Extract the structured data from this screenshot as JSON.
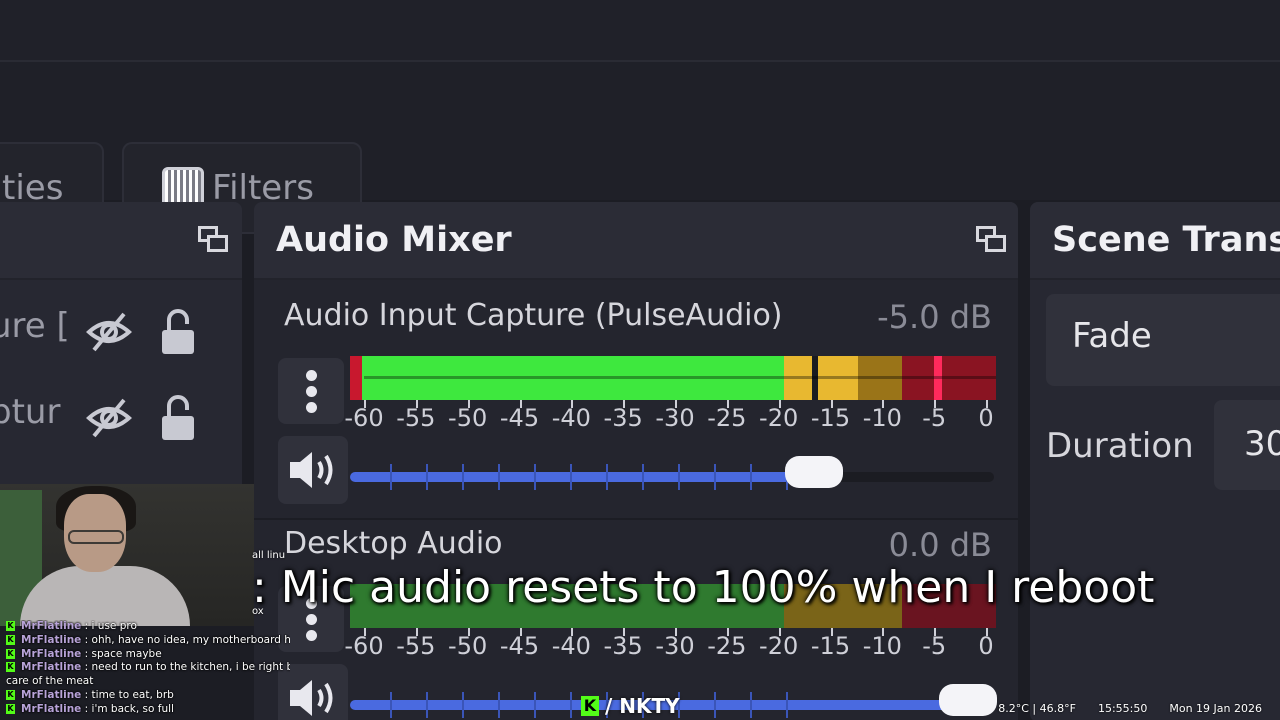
{
  "tabs": {
    "properties_label": "ties",
    "filters_label": "Filters"
  },
  "sources_dock": {
    "rows": [
      {
        "label": "ure ["
      },
      {
        "label": "ptur"
      }
    ]
  },
  "mixer": {
    "title": "Audio Mixer",
    "scale_labels": [
      "-60",
      "-55",
      "-50",
      "-45",
      "-40",
      "-35",
      "-30",
      "-25",
      "-20",
      "-15",
      "-10",
      "-5",
      "0"
    ],
    "channels": [
      {
        "name": "Audio Input Capture (PulseAudio)",
        "db": "-5.0 dB",
        "volume_fraction": 0.72
      },
      {
        "name": "Desktop Audio",
        "db": "0.0 dB",
        "volume_fraction": 0.96
      }
    ]
  },
  "transitions": {
    "title": "Scene Transi",
    "selected": "Fade",
    "duration_label": "Duration",
    "duration_value": "30"
  },
  "chat": {
    "lines": [
      {
        "user": "MrFlatline",
        "text": ": i use pro"
      },
      {
        "user": "MrFlatline",
        "text": ": ohh, have no idea, my motherboard has"
      },
      {
        "user": "MrFlatline",
        "text": ": space maybe"
      },
      {
        "user": "MrFlatline",
        "text": ": need to run to the kitchen, i be right ba"
      },
      {
        "user": "",
        "text": "care of the meat"
      },
      {
        "user": "MrFlatline",
        "text": ": time to eat, brb"
      },
      {
        "user": "MrFlatline",
        "text": ": i'm back, so full"
      }
    ],
    "stub_1": "all linu",
    "stub_2": "ox"
  },
  "caption": ": Mic audio resets to 100% when I reboot",
  "brand": {
    "letter": "K",
    "text": "/ NKTY"
  },
  "status": {
    "weather": "8.2°C | 46.8°F",
    "time": "15:55:50",
    "date": "Mon 19 Jan 2026"
  },
  "colors": {
    "meter_green": "#3ee83e",
    "meter_yellow": "#e8b830",
    "meter_red": "#c8182e",
    "slider_blue": "#4a6ae0",
    "kick_green": "#53fc18"
  }
}
